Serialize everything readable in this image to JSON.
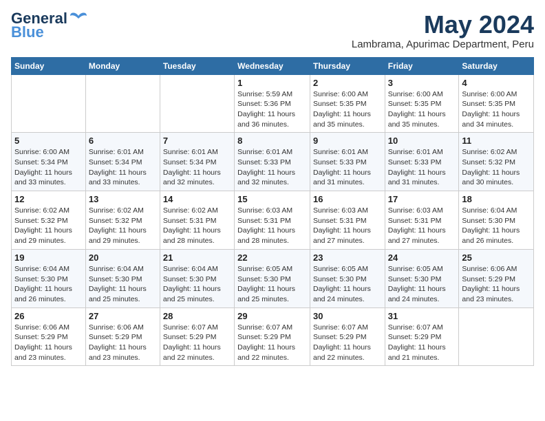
{
  "header": {
    "logo_line1": "General",
    "logo_line2": "Blue",
    "month": "May 2024",
    "location": "Lambrama, Apurimac Department, Peru"
  },
  "days_of_week": [
    "Sunday",
    "Monday",
    "Tuesday",
    "Wednesday",
    "Thursday",
    "Friday",
    "Saturday"
  ],
  "weeks": [
    [
      {
        "num": "",
        "info": ""
      },
      {
        "num": "",
        "info": ""
      },
      {
        "num": "",
        "info": ""
      },
      {
        "num": "1",
        "info": "Sunrise: 5:59 AM\nSunset: 5:36 PM\nDaylight: 11 hours and 36 minutes."
      },
      {
        "num": "2",
        "info": "Sunrise: 6:00 AM\nSunset: 5:35 PM\nDaylight: 11 hours and 35 minutes."
      },
      {
        "num": "3",
        "info": "Sunrise: 6:00 AM\nSunset: 5:35 PM\nDaylight: 11 hours and 35 minutes."
      },
      {
        "num": "4",
        "info": "Sunrise: 6:00 AM\nSunset: 5:35 PM\nDaylight: 11 hours and 34 minutes."
      }
    ],
    [
      {
        "num": "5",
        "info": "Sunrise: 6:00 AM\nSunset: 5:34 PM\nDaylight: 11 hours and 33 minutes."
      },
      {
        "num": "6",
        "info": "Sunrise: 6:01 AM\nSunset: 5:34 PM\nDaylight: 11 hours and 33 minutes."
      },
      {
        "num": "7",
        "info": "Sunrise: 6:01 AM\nSunset: 5:34 PM\nDaylight: 11 hours and 32 minutes."
      },
      {
        "num": "8",
        "info": "Sunrise: 6:01 AM\nSunset: 5:33 PM\nDaylight: 11 hours and 32 minutes."
      },
      {
        "num": "9",
        "info": "Sunrise: 6:01 AM\nSunset: 5:33 PM\nDaylight: 11 hours and 31 minutes."
      },
      {
        "num": "10",
        "info": "Sunrise: 6:01 AM\nSunset: 5:33 PM\nDaylight: 11 hours and 31 minutes."
      },
      {
        "num": "11",
        "info": "Sunrise: 6:02 AM\nSunset: 5:32 PM\nDaylight: 11 hours and 30 minutes."
      }
    ],
    [
      {
        "num": "12",
        "info": "Sunrise: 6:02 AM\nSunset: 5:32 PM\nDaylight: 11 hours and 29 minutes."
      },
      {
        "num": "13",
        "info": "Sunrise: 6:02 AM\nSunset: 5:32 PM\nDaylight: 11 hours and 29 minutes."
      },
      {
        "num": "14",
        "info": "Sunrise: 6:02 AM\nSunset: 5:31 PM\nDaylight: 11 hours and 28 minutes."
      },
      {
        "num": "15",
        "info": "Sunrise: 6:03 AM\nSunset: 5:31 PM\nDaylight: 11 hours and 28 minutes."
      },
      {
        "num": "16",
        "info": "Sunrise: 6:03 AM\nSunset: 5:31 PM\nDaylight: 11 hours and 27 minutes."
      },
      {
        "num": "17",
        "info": "Sunrise: 6:03 AM\nSunset: 5:31 PM\nDaylight: 11 hours and 27 minutes."
      },
      {
        "num": "18",
        "info": "Sunrise: 6:04 AM\nSunset: 5:30 PM\nDaylight: 11 hours and 26 minutes."
      }
    ],
    [
      {
        "num": "19",
        "info": "Sunrise: 6:04 AM\nSunset: 5:30 PM\nDaylight: 11 hours and 26 minutes."
      },
      {
        "num": "20",
        "info": "Sunrise: 6:04 AM\nSunset: 5:30 PM\nDaylight: 11 hours and 25 minutes."
      },
      {
        "num": "21",
        "info": "Sunrise: 6:04 AM\nSunset: 5:30 PM\nDaylight: 11 hours and 25 minutes."
      },
      {
        "num": "22",
        "info": "Sunrise: 6:05 AM\nSunset: 5:30 PM\nDaylight: 11 hours and 25 minutes."
      },
      {
        "num": "23",
        "info": "Sunrise: 6:05 AM\nSunset: 5:30 PM\nDaylight: 11 hours and 24 minutes."
      },
      {
        "num": "24",
        "info": "Sunrise: 6:05 AM\nSunset: 5:30 PM\nDaylight: 11 hours and 24 minutes."
      },
      {
        "num": "25",
        "info": "Sunrise: 6:06 AM\nSunset: 5:29 PM\nDaylight: 11 hours and 23 minutes."
      }
    ],
    [
      {
        "num": "26",
        "info": "Sunrise: 6:06 AM\nSunset: 5:29 PM\nDaylight: 11 hours and 23 minutes."
      },
      {
        "num": "27",
        "info": "Sunrise: 6:06 AM\nSunset: 5:29 PM\nDaylight: 11 hours and 23 minutes."
      },
      {
        "num": "28",
        "info": "Sunrise: 6:07 AM\nSunset: 5:29 PM\nDaylight: 11 hours and 22 minutes."
      },
      {
        "num": "29",
        "info": "Sunrise: 6:07 AM\nSunset: 5:29 PM\nDaylight: 11 hours and 22 minutes."
      },
      {
        "num": "30",
        "info": "Sunrise: 6:07 AM\nSunset: 5:29 PM\nDaylight: 11 hours and 22 minutes."
      },
      {
        "num": "31",
        "info": "Sunrise: 6:07 AM\nSunset: 5:29 PM\nDaylight: 11 hours and 21 minutes."
      },
      {
        "num": "",
        "info": ""
      }
    ]
  ]
}
